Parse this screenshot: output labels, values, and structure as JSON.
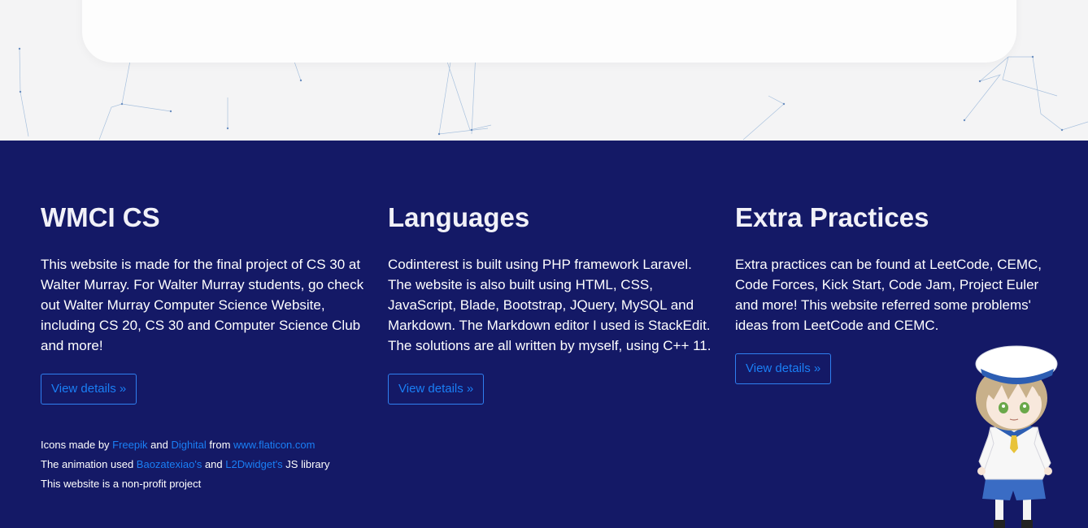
{
  "columns": [
    {
      "title": "WMCI CS",
      "body": "This website is made for the final project of CS 30 at Walter Murray. For Walter Murray students, go check out Walter Murray Computer Science Website, including CS 20, CS 30 and Computer Science Club and more!",
      "button": "View details »"
    },
    {
      "title": "Languages",
      "body": "Codinterest is built using PHP framework Laravel. The website is also built using HTML, CSS, JavaScript, Blade, Bootstrap, JQuery, MySQL and Markdown. The Markdown editor I used is StackEdit. The solutions are all written by myself, using C++ 11.",
      "button": "View details »"
    },
    {
      "title": "Extra Practices",
      "body": "Extra practices can be found at LeetCode, CEMC, Code Forces, Kick Start, Code Jam, Project Euler and more! This website referred some problems' ideas from LeetCode and CEMC.",
      "button": "View details »"
    }
  ],
  "credits": {
    "line1_a": "Icons made by ",
    "link_freepik": "Freepik",
    "line1_b": " and ",
    "link_dighital": "Dighital",
    "line1_c": " from ",
    "link_flaticon": "www.flaticon.com",
    "line2_a": "The animation used ",
    "link_baozatexiao": "Baozatexiao's",
    "line2_b": " and ",
    "link_l2dwidget": "L2Dwidget's",
    "line2_c": " JS library",
    "line3": "This website is a non-profit project"
  },
  "colors": {
    "footer_bg": "#141966",
    "link": "#1a7ff5",
    "page_bg": "#f4f4f5"
  }
}
